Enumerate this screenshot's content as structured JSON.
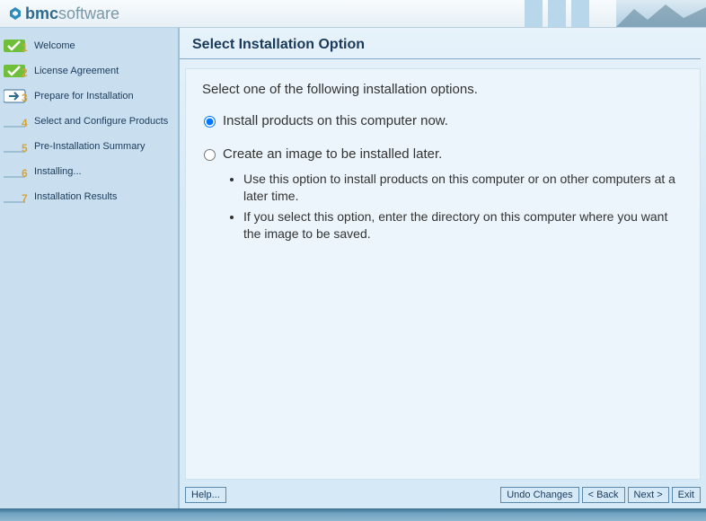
{
  "brand": {
    "bold": "bmc",
    "light": "software"
  },
  "sidebar": {
    "steps": [
      {
        "label": "Welcome",
        "status": "done",
        "num": "1"
      },
      {
        "label": "License Agreement",
        "status": "done",
        "num": "2"
      },
      {
        "label": "Prepare for Installation",
        "status": "current",
        "num": "3"
      },
      {
        "label": "Select and Configure Products",
        "status": "pending",
        "num": "4"
      },
      {
        "label": "Pre-Installation Summary",
        "status": "pending",
        "num": "5"
      },
      {
        "label": "Installing...",
        "status": "pending",
        "num": "6"
      },
      {
        "label": "Installation Results",
        "status": "pending",
        "num": "7"
      }
    ]
  },
  "page": {
    "title": "Select Installation Option",
    "intro": "Select one of the following installation options.",
    "option1": {
      "label": "Install products on this computer now.",
      "selected": true
    },
    "option2": {
      "label": "Create an image to be installed later.",
      "selected": false,
      "bullets": [
        "Use this option to install products on this computer or on other computers at a later time.",
        "If you select this option, enter the directory on this computer where you want the image to be saved."
      ]
    }
  },
  "footer": {
    "help": "Help...",
    "undo": "Undo Changes",
    "back": "< Back",
    "next": "Next >",
    "exit": "Exit"
  }
}
